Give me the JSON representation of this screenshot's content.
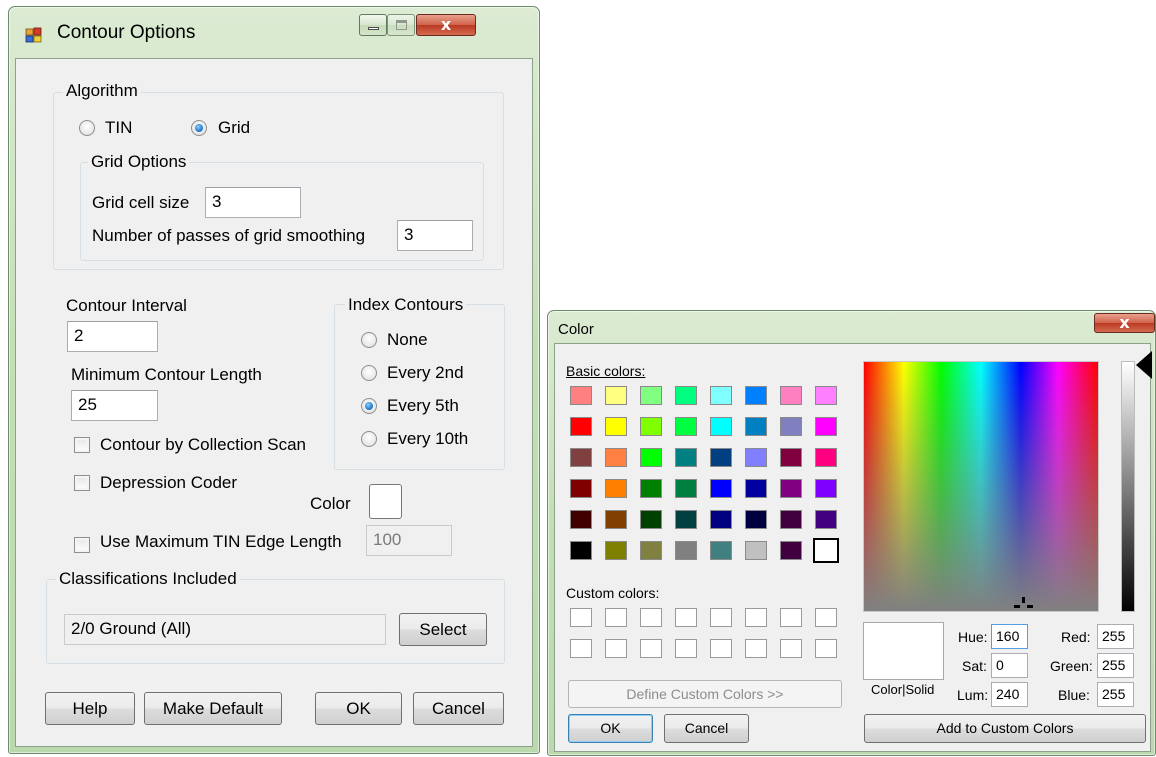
{
  "contour_dialog": {
    "title": "Contour Options",
    "controls": {
      "close_glyph": "x",
      "title_icon": "app-icon"
    },
    "algorithm": {
      "group_label": "Algorithm",
      "options": [
        {
          "label": "TIN",
          "selected": false
        },
        {
          "label": "Grid",
          "selected": true
        }
      ],
      "grid_options": {
        "group_label": "Grid Options",
        "cell_size_label": "Grid cell size",
        "cell_size_value": "3",
        "passes_label": "Number of passes of grid smoothing",
        "passes_value": "3"
      }
    },
    "contour_interval": {
      "label": "Contour Interval",
      "value": "2"
    },
    "min_contour_length": {
      "label": "Minimum Contour Length",
      "value": "25"
    },
    "contour_by_collection_scan": {
      "label": "Contour by Collection Scan",
      "checked": false
    },
    "depression_coder": {
      "label": "Depression Coder",
      "checked": false
    },
    "color": {
      "label": "Color",
      "value": "#ffffff"
    },
    "use_max_tin_edge": {
      "label": "Use Maximum TIN Edge Length",
      "checked": false,
      "value": "100"
    },
    "index_contours": {
      "group_label": "Index Contours",
      "options": [
        {
          "label": "None",
          "selected": false
        },
        {
          "label": "Every 2nd",
          "selected": false
        },
        {
          "label": "Every 5th",
          "selected": true
        },
        {
          "label": "Every 10th",
          "selected": false
        }
      ]
    },
    "classifications": {
      "group_label": "Classifications Included",
      "value": "2/0 Ground (All)",
      "select_label": "Select"
    },
    "buttons": {
      "help": "Help",
      "make_default": "Make Default",
      "ok": "OK",
      "cancel": "Cancel"
    }
  },
  "color_dialog": {
    "title": "Color",
    "close_glyph": "x",
    "basic_colors_label": "Basic colors:",
    "basic_colors": [
      [
        "#ff8080",
        "#ffff80",
        "#80ff80",
        "#00ff80",
        "#80ffff",
        "#0080ff",
        "#ff80c0",
        "#ff80ff"
      ],
      [
        "#ff0000",
        "#ffff00",
        "#80ff00",
        "#00ff40",
        "#00ffff",
        "#0080c0",
        "#8080c0",
        "#ff00ff"
      ],
      [
        "#804040",
        "#ff8040",
        "#00ff00",
        "#008080",
        "#004080",
        "#8080ff",
        "#800040",
        "#ff0080"
      ],
      [
        "#800000",
        "#ff8000",
        "#008000",
        "#008040",
        "#0000ff",
        "#0000a0",
        "#800080",
        "#8000ff"
      ],
      [
        "#400000",
        "#804000",
        "#004000",
        "#004040",
        "#000080",
        "#000040",
        "#400040",
        "#400080"
      ],
      [
        "#000000",
        "#808000",
        "#808040",
        "#808080",
        "#408080",
        "#c0c0c0",
        "#400040",
        "#ffffff"
      ]
    ],
    "selected_basic_color": "#ffffff",
    "custom_colors_label": "Custom colors:",
    "define_custom_label": "Define Custom Colors >>",
    "ok_label": "OK",
    "cancel_label": "Cancel",
    "color_solid_label": "Color|Solid",
    "fields": {
      "hue": {
        "label": "Hue:",
        "value": "160"
      },
      "sat": {
        "label": "Sat:",
        "value": "0"
      },
      "lum": {
        "label": "Lum:",
        "value": "240"
      },
      "red": {
        "label": "Red:",
        "value": "255"
      },
      "green": {
        "label": "Green:",
        "value": "255"
      },
      "blue": {
        "label": "Blue:",
        "value": "255"
      }
    },
    "add_custom_label": "Add to Custom Colors"
  }
}
